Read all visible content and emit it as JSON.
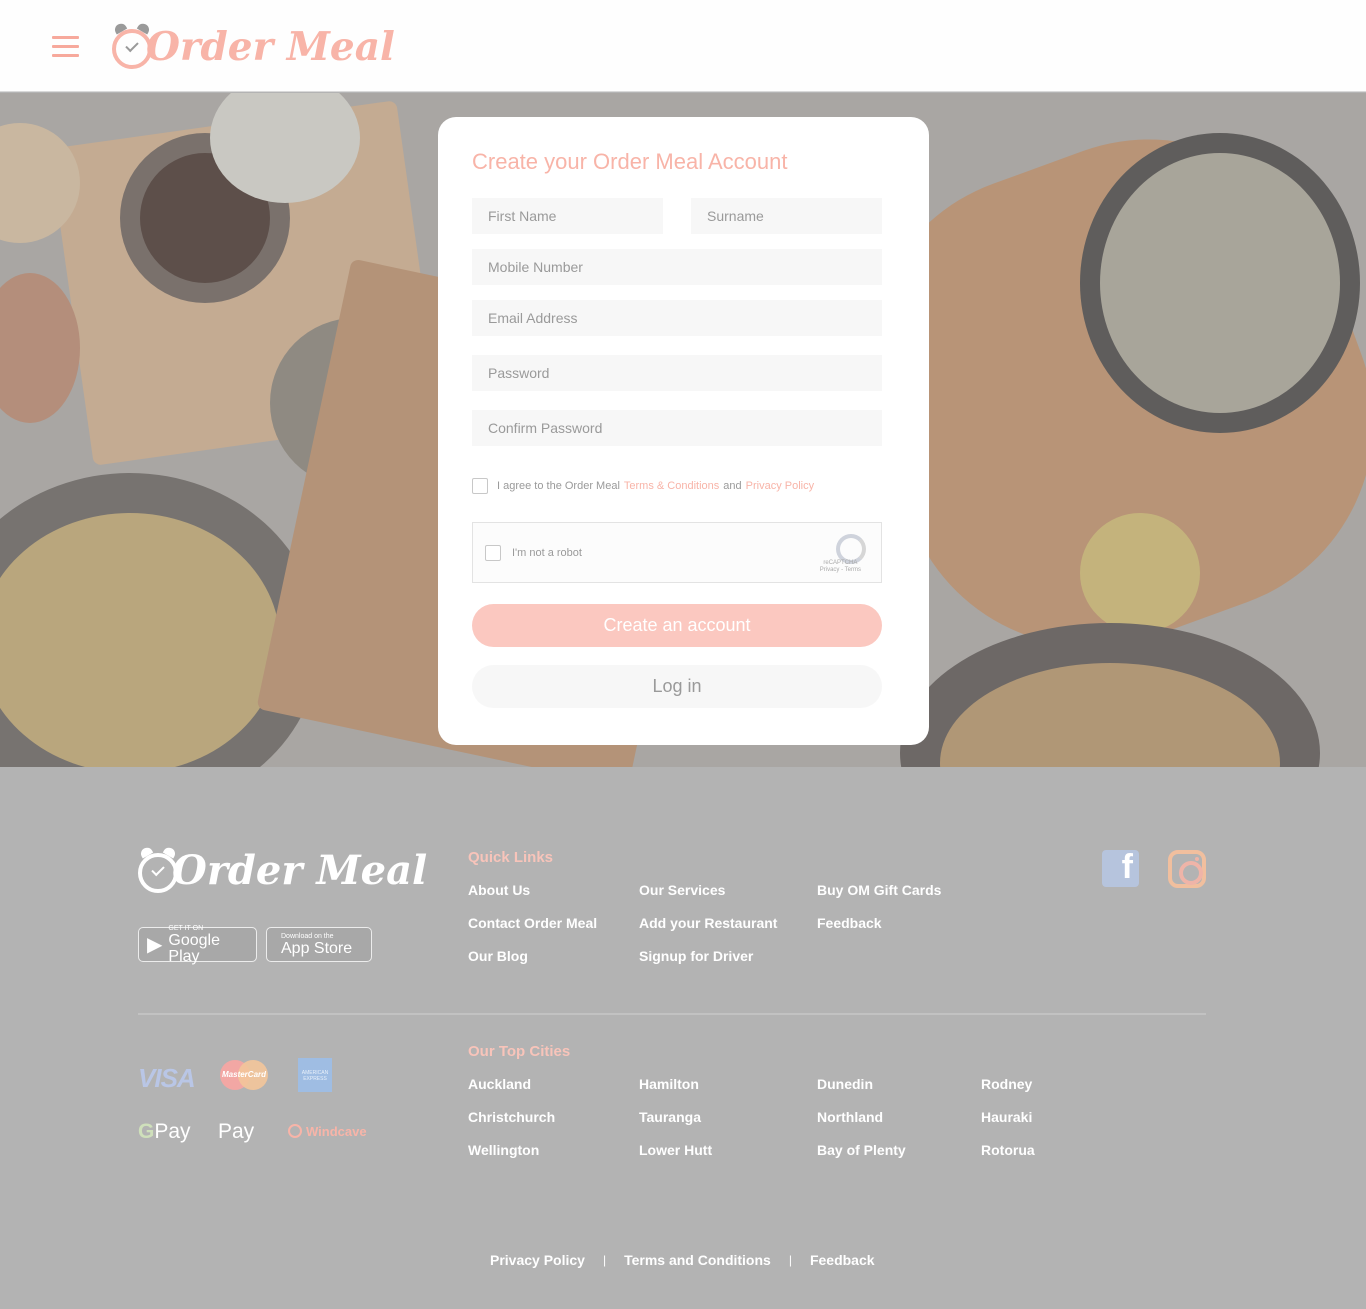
{
  "brand": {
    "name": "Order Meal",
    "accent": "#f8b4a8",
    "button_color": "#fbc8c0"
  },
  "header": {
    "menu_icon": "hamburger-icon"
  },
  "signup": {
    "title": "Create your Order Meal Account",
    "first_name_placeholder": "First Name",
    "surname_placeholder": "Surname",
    "mobile_placeholder": "Mobile Number",
    "email_placeholder": "Email Address",
    "password_placeholder": "Password",
    "confirm_password_placeholder": "Confirm Password",
    "agree_prefix": "I agree to the Order Meal",
    "terms_link": "Terms & Conditions",
    "agree_and": "and",
    "privacy_link": "Privacy Policy",
    "captcha_label": "I'm not a robot",
    "captcha_brand": "reCAPTCHA",
    "captcha_sub": "Privacy - Terms",
    "create_button": "Create an account",
    "login_button": "Log in"
  },
  "footer": {
    "stores": [
      {
        "small": "GET IT ON",
        "big": "Google Play",
        "icon": "google-play-icon"
      },
      {
        "small": "Download on the",
        "big": "App Store",
        "icon": "apple-icon"
      }
    ],
    "quick_links_title": "Quick Links",
    "quick_links": [
      "About Us",
      "Contact Order Meal",
      "Our Blog",
      "Our Services",
      "Add your Restaurant",
      "Signup for Driver",
      "Buy OM Gift Cards",
      "Feedback"
    ],
    "social": [
      "facebook-icon",
      "instagram-icon"
    ],
    "payments": {
      "visa": "VISA",
      "mastercard": "MasterCard",
      "amex": "AMERICAN EXPRESS",
      "gpay_g": "G",
      "gpay": "Pay",
      "applepay": "Pay",
      "windcave": "Windcave"
    },
    "cities_title": "Our Top Cities",
    "cities": [
      "Auckland",
      "Christchurch",
      "Wellington",
      "Hamilton",
      "Tauranga",
      "Lower Hutt",
      "Dunedin",
      "Northland",
      "Bay of Plenty",
      "Rodney",
      "Hauraki",
      "Rotorua"
    ],
    "bottom_links": [
      "Privacy Policy",
      "Terms and Conditions",
      "Feedback"
    ],
    "bottom_sep": "|"
  }
}
